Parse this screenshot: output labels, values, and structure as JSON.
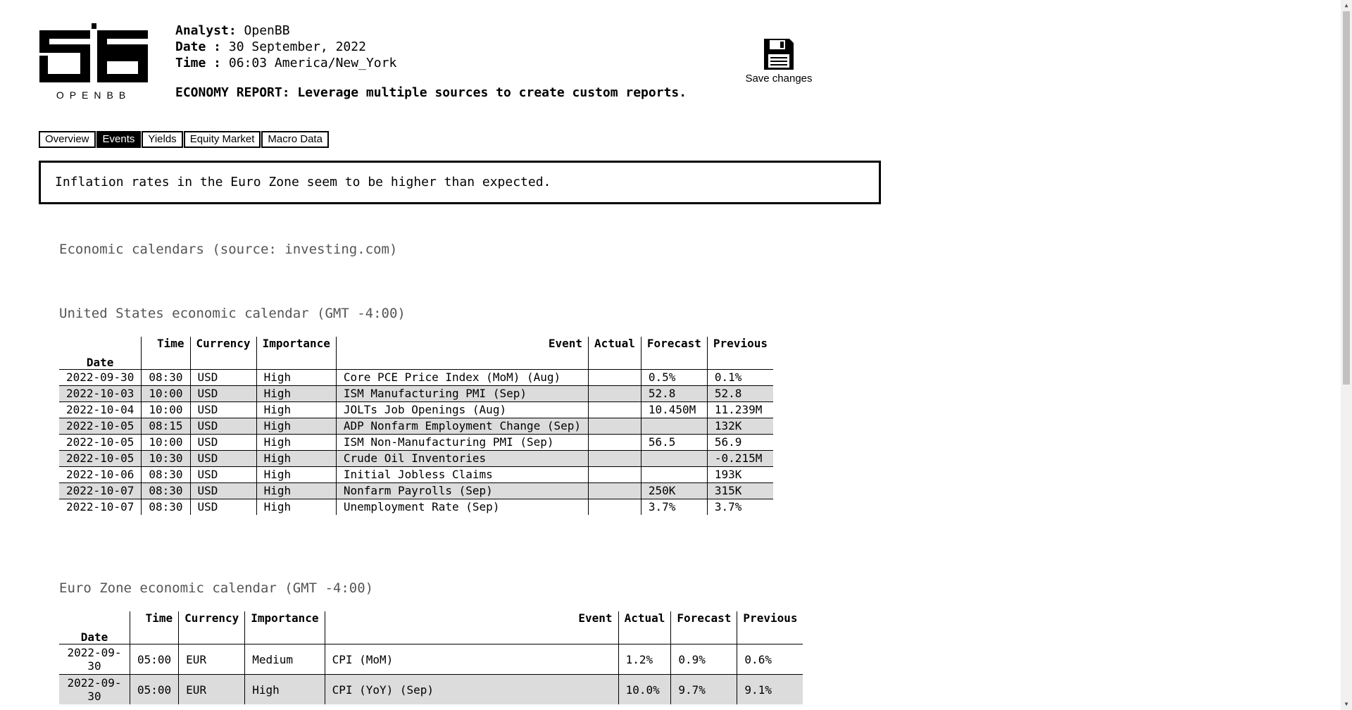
{
  "header": {
    "logo_text": "OPENBB",
    "analyst_label": "Analyst:",
    "analyst_value": "OpenBB",
    "date_label": "Date :",
    "date_value": "30 September, 2022",
    "time_label": "Time :",
    "time_value": "06:03 America/New_York",
    "report_title": "ECONOMY REPORT: Leverage multiple sources to create custom reports.",
    "save_label": "Save changes"
  },
  "tabs": [
    "Overview",
    "Events",
    "Yields",
    "Equity Market",
    "Macro Data"
  ],
  "active_tab": "Events",
  "summary": "Inflation rates in the Euro Zone seem to be higher than expected.",
  "sections": {
    "calendars_title": "Economic calendars (source: investing.com)",
    "us_title": "United States economic calendar (GMT -4:00)",
    "eu_title": "Euro Zone economic calendar (GMT -4:00)"
  },
  "columns": [
    "Date",
    "Time",
    "Currency",
    "Importance",
    "Event",
    "Actual",
    "Forecast",
    "Previous"
  ],
  "us_calendar": [
    [
      "2022-09-30",
      "08:30",
      "USD",
      "High",
      "Core PCE Price Index (MoM) (Aug)",
      "",
      "0.5%",
      "0.1%"
    ],
    [
      "2022-10-03",
      "10:00",
      "USD",
      "High",
      "ISM Manufacturing PMI (Sep)",
      "",
      "52.8",
      "52.8"
    ],
    [
      "2022-10-04",
      "10:00",
      "USD",
      "High",
      "JOLTs Job Openings (Aug)",
      "",
      "10.450M",
      "11.239M"
    ],
    [
      "2022-10-05",
      "08:15",
      "USD",
      "High",
      "ADP Nonfarm Employment Change (Sep)",
      "",
      "",
      "132K"
    ],
    [
      "2022-10-05",
      "10:00",
      "USD",
      "High",
      "ISM Non-Manufacturing PMI (Sep)",
      "",
      "56.5",
      "56.9"
    ],
    [
      "2022-10-05",
      "10:30",
      "USD",
      "High",
      "Crude Oil Inventories",
      "",
      "",
      "-0.215M"
    ],
    [
      "2022-10-06",
      "08:30",
      "USD",
      "High",
      "Initial Jobless Claims",
      "",
      "",
      "193K"
    ],
    [
      "2022-10-07",
      "08:30",
      "USD",
      "High",
      "Nonfarm Payrolls (Sep)",
      "",
      "250K",
      "315K"
    ],
    [
      "2022-10-07",
      "08:30",
      "USD",
      "High",
      "Unemployment Rate (Sep)",
      "",
      "3.7%",
      "3.7%"
    ]
  ],
  "eu_calendar": [
    [
      "2022-09-30",
      "05:00",
      "EUR",
      "Medium",
      "CPI (MoM)",
      "1.2%",
      "0.9%",
      "0.6%"
    ],
    [
      "2022-09-30",
      "05:00",
      "EUR",
      "High",
      "CPI (YoY) (Sep)",
      "10.0%",
      "9.7%",
      "9.1%"
    ]
  ]
}
